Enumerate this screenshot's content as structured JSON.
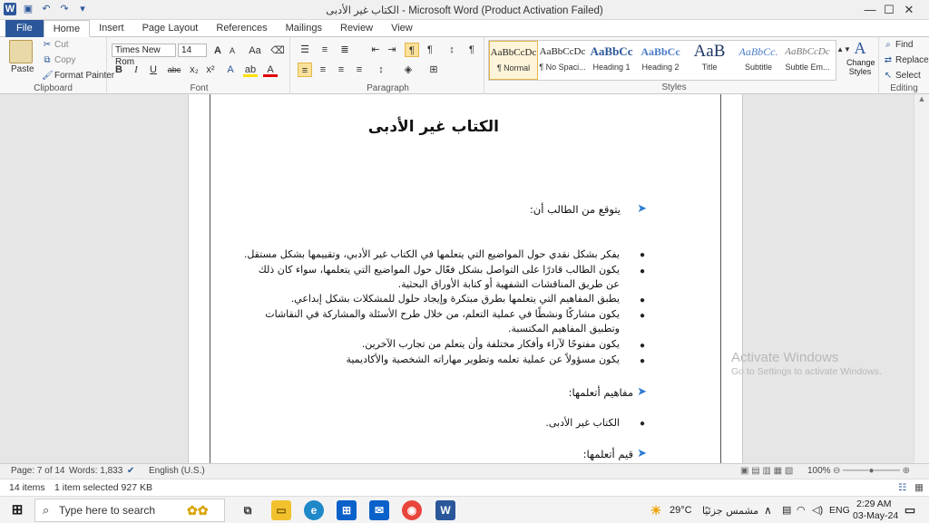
{
  "app": {
    "title": "الكتاب غير الأدبى  -  Microsoft Word (Product Activation Failed)",
    "word_logo": "W",
    "save_icon": "save-icon",
    "undo_icon": "undo-icon",
    "redo_icon": "redo-icon",
    "minimize": "—",
    "maximize": "☐",
    "close": "✕"
  },
  "tabs": [
    "File",
    "Home",
    "Insert",
    "Page Layout",
    "References",
    "Mailings",
    "Review",
    "View"
  ],
  "ribbon": {
    "clipboard": {
      "paste": "Paste",
      "cut": "Cut",
      "copy": "Copy",
      "format_painter": "Format Painter",
      "label": "Clipboard"
    },
    "font": {
      "name": "Times New Rom",
      "size": "14",
      "label": "Font",
      "grow": "A",
      "shrink": "A",
      "case": "Aa",
      "bold": "B",
      "italic": "I",
      "underline": "U",
      "strike": "abc",
      "sub": "x₂",
      "sup": "x²"
    },
    "paragraph": {
      "label": "Paragraph"
    },
    "styles": {
      "label": "Styles",
      "items": [
        {
          "preview": "AaBbCcDc",
          "name": "¶ Normal"
        },
        {
          "preview": "AaBbCcDc",
          "name": "¶ No Spaci..."
        },
        {
          "preview": "AaBbCc",
          "name": "Heading 1"
        },
        {
          "preview": "AaBbCc",
          "name": "Heading 2"
        },
        {
          "preview": "AaB",
          "name": "Title"
        },
        {
          "preview": "AaBbCc.",
          "name": "Subtitle"
        },
        {
          "preview": "AaBbCcDc",
          "name": "Subtle Em..."
        }
      ],
      "change_styles": "Change Styles"
    },
    "editing": {
      "find": "Find",
      "replace": "Replace",
      "select": "Select",
      "label": "Editing"
    }
  },
  "document": {
    "title": "الكتاب غير الأدبى",
    "intro": "يتوقع من الطالب أن:",
    "bullets": [
      "يفكر بشكل نقدي حول المواضيع التي يتعلمها في الكتاب غير الأدبي، وتقييمها بشكل مستقل.",
      "يكون الطالب قادرًا على التواصل بشكل فعّال حول المواضيع التي يتعلمها، سواء كان ذلك",
      "عن طريق المناقشات الشفهية أو كتابة الأوراق البحثية.",
      "يطبق المفاهيم التي يتعلمها بطرق مبتكرة وإيجاد حلول للمشكلات بشكل إبداعي.",
      "يكون مشاركًا ونشطًا في عملية التعلم، من خلال طرح الأسئلة والمشاركة في النقاشات",
      "وتطبيق المفاهيم المكتسبة.",
      "يكون مفتوحًا لآراء وأفكار مختلفة وأن يتعلم من تجارب الآخرين.",
      "يكون مسؤولاً عن عملية تعلمه وتطوير مهاراته الشخصية والأكاديمية"
    ],
    "concepts_heading": "مفاهيم أتعلمها:",
    "concepts": [
      "الكتاب غير الأدبى."
    ],
    "values_heading": "قيم أتعلمها:"
  },
  "watermark": {
    "line1": "Activate Windows",
    "line2": "Go to Settings to activate Windows."
  },
  "status": {
    "page": "Page: 7 of 14",
    "words": "Words: 1,833",
    "language": "English (U.S.)",
    "zoom": "100%"
  },
  "explorer": {
    "items": "14 items",
    "selected": "1 item selected  927 KB"
  },
  "taskbar": {
    "search_placeholder": "Type here to search",
    "weather": "29°C",
    "weather_text": "مشمس جزئيًا",
    "lang": "ENG",
    "time": "2:29 AM",
    "date": "03-May-24"
  },
  "colors": {
    "accent": "#2b579a",
    "arrow": "#2f7dd1"
  }
}
